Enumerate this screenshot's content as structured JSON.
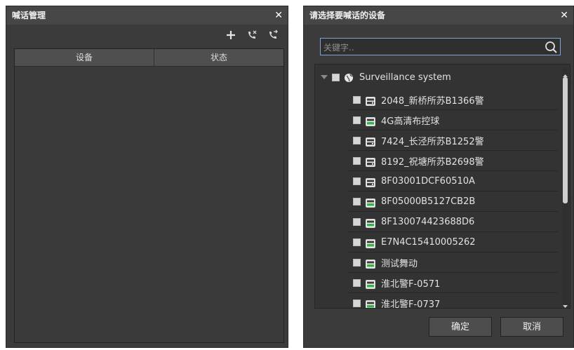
{
  "left_panel": {
    "title": "喊话管理",
    "close": "✕",
    "toolbar": [
      "add-icon",
      "call-icon",
      "hangup-icon"
    ],
    "table": {
      "columns": [
        "设备",
        "状态"
      ],
      "rows": []
    }
  },
  "right_panel": {
    "title": "请选择要喊话的设备",
    "close": "✕",
    "search": {
      "placeholder": "关键字..",
      "value": ""
    },
    "tree": {
      "root": "Surveillance system",
      "devices": [
        {
          "label": "2048_新桥所苏B1366警",
          "status": "offline"
        },
        {
          "label": "4G高清布控球",
          "status": "online"
        },
        {
          "label": "7424_长泾所苏B1252警",
          "status": "offline"
        },
        {
          "label": "8192_祝塘所苏B2698警",
          "status": "offline"
        },
        {
          "label": "8F03001DCF60510A",
          "status": "offline"
        },
        {
          "label": "8F05000B5127CB2B",
          "status": "online"
        },
        {
          "label": "8F130074423688D6",
          "status": "online"
        },
        {
          "label": "E7N4C15410005262",
          "status": "online"
        },
        {
          "label": "测试舞动",
          "status": "online"
        },
        {
          "label": "淮北警F-0571",
          "status": "online"
        },
        {
          "label": "淮北警F-0737",
          "status": "online"
        }
      ]
    },
    "buttons": {
      "ok": "确定",
      "cancel": "取消"
    }
  },
  "colors": {
    "panel_bg": "#3b3b3b",
    "titlebar_bg": "#464646",
    "header_bg": "#4f4f4f",
    "search_border": "#7fa5d8",
    "online_green": "#35b24a"
  }
}
